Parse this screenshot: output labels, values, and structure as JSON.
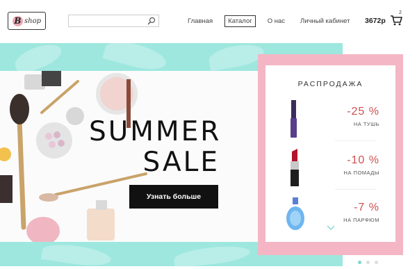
{
  "header": {
    "logo_initial": "B",
    "logo_text": "shop",
    "search": {
      "value": "",
      "placeholder": ""
    },
    "nav": [
      {
        "label": "Главная",
        "active": false
      },
      {
        "label": "Каталог",
        "active": true
      },
      {
        "label": "О нас",
        "active": false
      },
      {
        "label": "Личный кабинет",
        "active": false
      }
    ],
    "cart_total": "3672р",
    "cart_count": "2"
  },
  "banner": {
    "title_line1": "SUMMER",
    "title_line2": "SALE",
    "cta_label": "Узнать больше",
    "accent_color": "#9de7df"
  },
  "promo": {
    "title": "РАСПРОДАЖА",
    "items": [
      {
        "discount": "-25 %",
        "caption": "НА ТУШЬ",
        "icon": "mascara-icon"
      },
      {
        "discount": "-10 %",
        "caption": "НА ПОМАДЫ",
        "icon": "lipstick-icon"
      },
      {
        "discount": "-7 %",
        "caption": "НА ПАРФЮМ",
        "icon": "perfume-icon"
      }
    ],
    "frame_color": "#f4b6c4",
    "discount_color": "#d04e4e"
  },
  "slider": {
    "total": 3,
    "active": 1
  }
}
